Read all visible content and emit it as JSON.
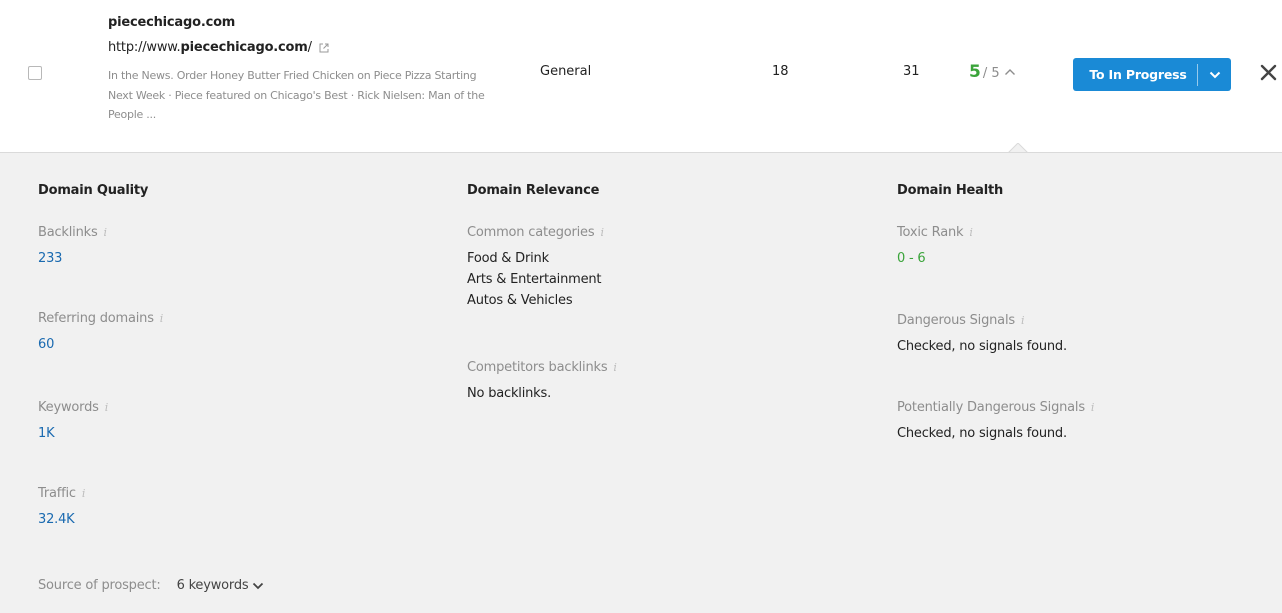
{
  "row": {
    "domain": "piecechicago.com",
    "url_prefix": "http://www.",
    "url_host": "piecechicago.com",
    "url_suffix": "/",
    "snippet": "In the News. Order Honey Butter Fried Chicken on Piece Pizza Starting Next Week · Piece featured on Chicago's Best · Rick Nielsen: Man of the People ...",
    "category": "General",
    "col_a": "18",
    "col_b": "31",
    "score": "5",
    "score_total": "/ 5",
    "action_label": "To In Progress",
    "icons": {
      "external_link": "external-link-icon",
      "expand": "chevron-up-icon",
      "dropdown": "chevron-down-icon",
      "close": "close-icon"
    }
  },
  "quality": {
    "heading": "Domain Quality",
    "backlinks_label": "Backlinks",
    "backlinks_value": "233",
    "referring_label": "Referring domains",
    "referring_value": "60",
    "keywords_label": "Keywords",
    "keywords_value": "1K",
    "traffic_label": "Traffic",
    "traffic_value": "32.4K"
  },
  "relevance": {
    "heading": "Domain Relevance",
    "categories_label": "Common categories",
    "categories": [
      "Food & Drink",
      "Arts & Entertainment",
      "Autos & Vehicles"
    ],
    "competitors_label": "Competitors backlinks",
    "competitors_value": "No backlinks."
  },
  "health": {
    "heading": "Domain Health",
    "toxic_label": "Toxic Rank",
    "toxic_value": "0 - 6",
    "dangerous_label": "Dangerous Signals",
    "dangerous_value": "Checked, no signals found.",
    "potential_label": "Potentially Dangerous Signals",
    "potential_value": "Checked, no signals found."
  },
  "source": {
    "label": "Source of prospect:",
    "value": "6 keywords"
  },
  "info_glyph": "i",
  "colors": {
    "accent": "#1a8ad6",
    "link": "#1a6ab0",
    "good": "#3aa43a",
    "panel_bg": "#f1f1f1"
  }
}
